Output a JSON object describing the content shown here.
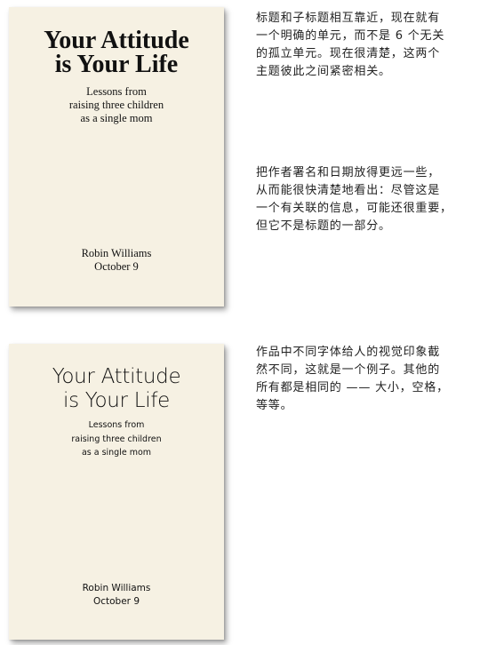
{
  "example_serif": {
    "title_lines": [
      "Your Attitude",
      "is Your Life"
    ],
    "subtitle_lines": [
      "Lessons from",
      "raising three children",
      "as a single mom"
    ],
    "author": "Robin Williams",
    "date": "October 9"
  },
  "example_sans": {
    "title_lines": [
      "Your Attitude",
      "is Your Life"
    ],
    "subtitle_lines": [
      "Lessons from",
      "raising three children",
      "as a single mom"
    ],
    "author": "Robin Williams",
    "date": "October 9"
  },
  "notes": [
    {
      "lines": [
        "标题和子标题相互靠近，现在就有",
        "一个明确的单元，而不是 6 个无关",
        "的孤立单元。现在很清楚，这两个",
        "主题彼此之间紧密相关。"
      ]
    },
    {
      "lines": [
        "把作者署名和日期放得更远一些，",
        "从而能很快清楚地看出：尽管这是",
        "一个有关联的信息，可能还很重要，",
        "但它不是标题的一部分。"
      ]
    },
    {
      "lines": [
        "作品中不同字体给人的视觉印象截",
        "然不同，这就是一个例子。其他的",
        "所有都是相同的 —— 大小，空格，",
        "等等。"
      ]
    }
  ],
  "colors": {
    "card_background": "#f6f1e3",
    "text": "#111111"
  }
}
